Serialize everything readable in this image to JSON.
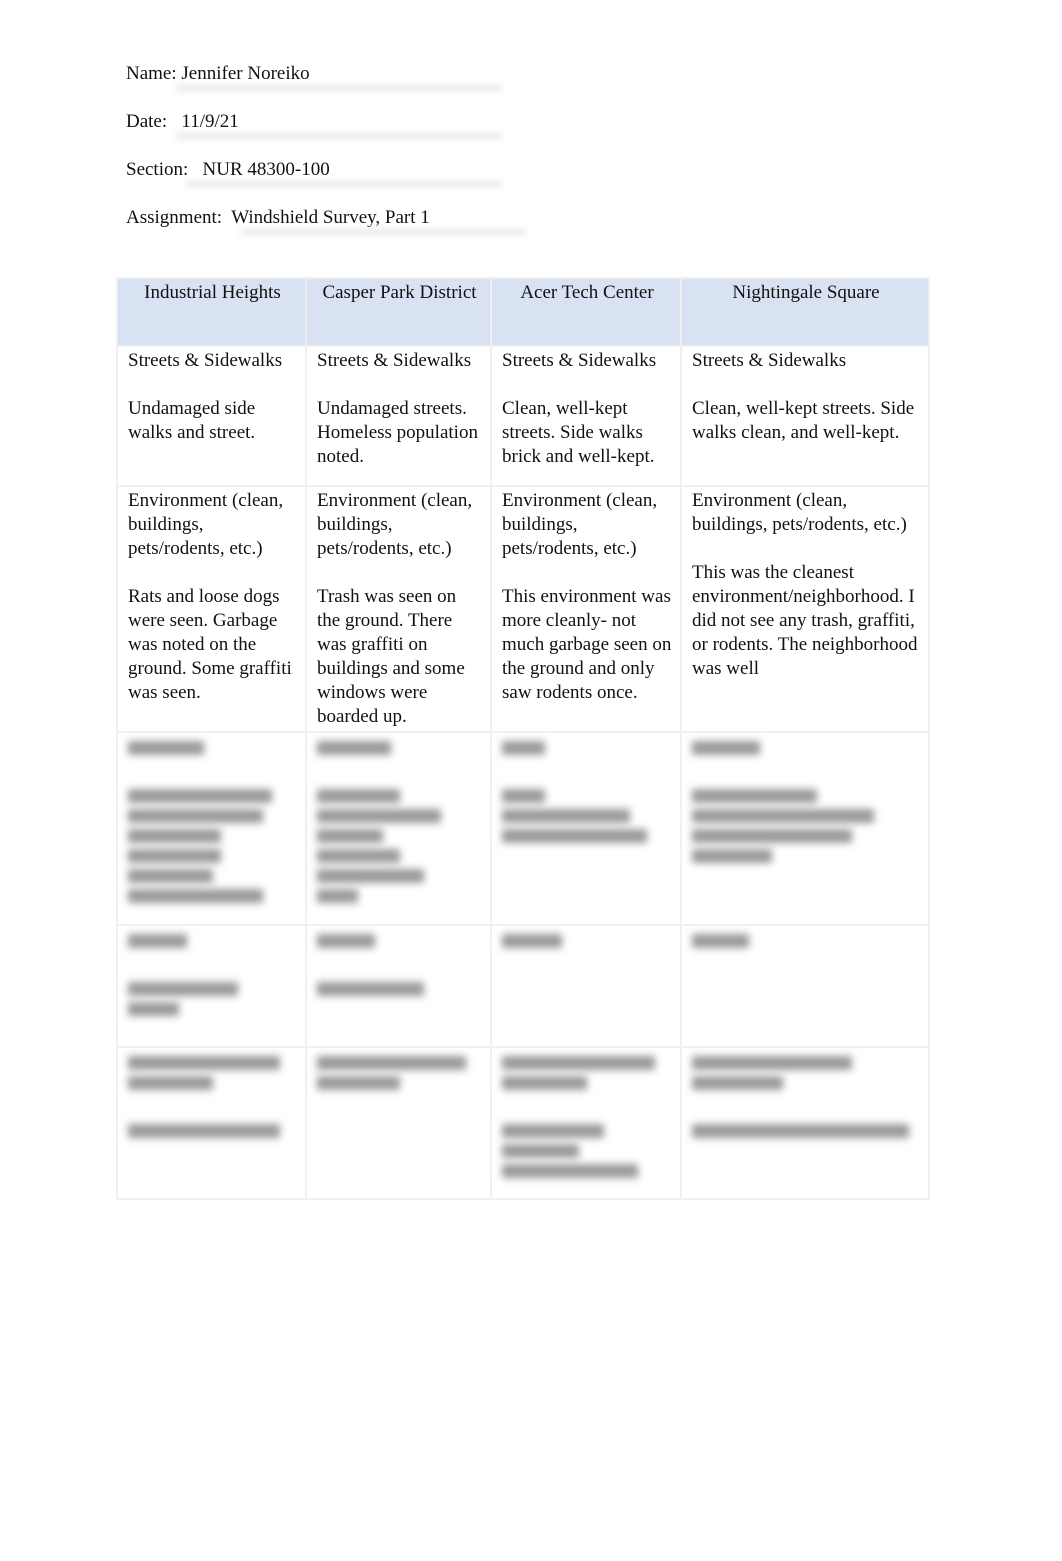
{
  "header": {
    "name_label": "Name:",
    "name_value": "Jennifer Noreiko",
    "date_label": "Date:",
    "date_value": "11/9/21",
    "section_label": "Section:",
    "section_value": "NUR 48300-100",
    "assignment_label": "Assignment:",
    "assignment_value": "Windshield Survey, Part 1"
  },
  "table": {
    "columns": [
      "Industrial Heights",
      "Casper Park District",
      "Acer Tech Center",
      "Nightingale Square"
    ],
    "header_color": "#d9e2f3",
    "rows": [
      {
        "heading": "Streets & Sidewalks",
        "cells": [
          "Undamaged side walks and street.",
          "Undamaged streets. Homeless population noted.",
          "Clean, well-kept streets. Side walks brick and well-kept.",
          "Clean, well-kept streets. Side walks clean, and well-kept."
        ]
      },
      {
        "heading": "Environment (clean, buildings, pets/rodents, etc.)",
        "cells": [
          "Rats and loose dogs were seen. Garbage was noted on the ground. Some graffiti was seen.",
          "Trash was seen on the ground. There was graffiti on buildings and some windows were boarded up.",
          "This environment was more cleanly- not much garbage seen on the ground and only saw rodents once.",
          "This was the cleanest environment/neighborhood. I did not see any trash, graffiti, or rodents. The neighborhood was well"
        ]
      }
    ]
  }
}
